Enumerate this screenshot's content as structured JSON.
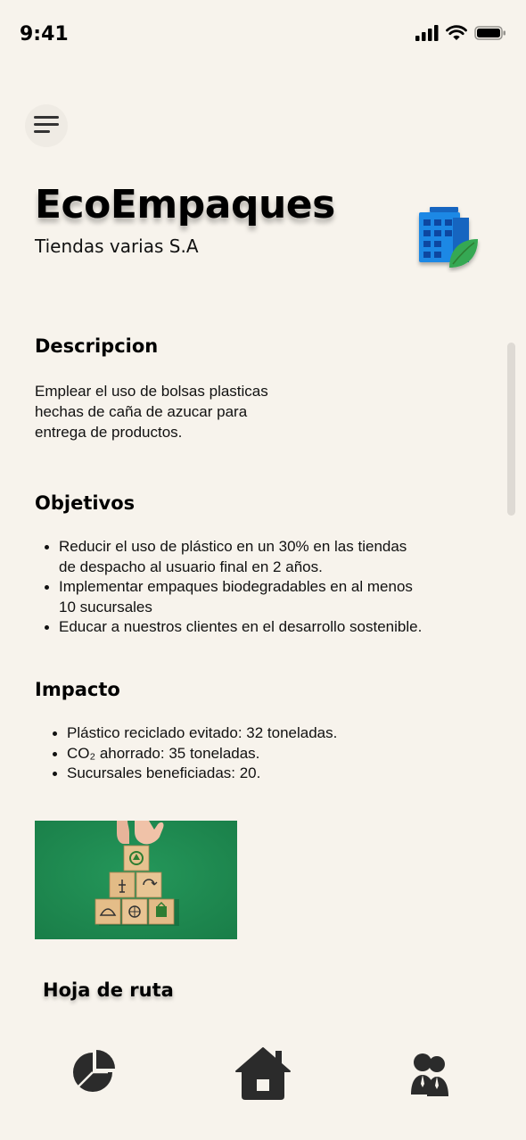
{
  "status_bar": {
    "time": "9:41",
    "icons": [
      "signal-icon",
      "wifi-icon",
      "battery-icon"
    ]
  },
  "header": {
    "menu_icon": "menu-icon",
    "title": "EcoEmpaques",
    "subtitle": "Tiendas varias S.A",
    "company_icon": "building-leaf-icon"
  },
  "descripcion": {
    "title": "Descripcion",
    "lines": [
      "Emplear el uso de bolsas plasticas",
      "hechas de caña de azucar para",
      "entrega de productos."
    ]
  },
  "objetivos": {
    "title": "Objetivos",
    "items": [
      [
        "Reducir el uso de plástico en un 30% en las tiendas",
        "de despacho al usuario final en 2 años."
      ],
      [
        "Implementar empaques biodegradables en al menos",
        "10 sucursales"
      ],
      [
        "Educar a nuestros clientes en el desarrollo sostenible."
      ]
    ]
  },
  "impacto": {
    "title": "Impacto",
    "items": [
      "Plástico reciclado evitado: 32 toneladas.",
      "CO₂ ahorrado: 35 toneladas.",
      "Sucursales beneficiadas: 20."
    ],
    "image_icon": "sustainability-blocks-image"
  },
  "hoja_de_ruta": {
    "title": "Hoja de ruta"
  },
  "bottom_nav": {
    "items": [
      {
        "icon": "pie-chart-icon"
      },
      {
        "icon": "home-icon"
      },
      {
        "icon": "users-icon"
      }
    ]
  },
  "colors": {
    "background": "#f7f3ec",
    "icon_dark": "#2b2b2b",
    "building_blue": "#1a73e8",
    "leaf_green": "#34a853",
    "image_green": "#1f8e52"
  }
}
